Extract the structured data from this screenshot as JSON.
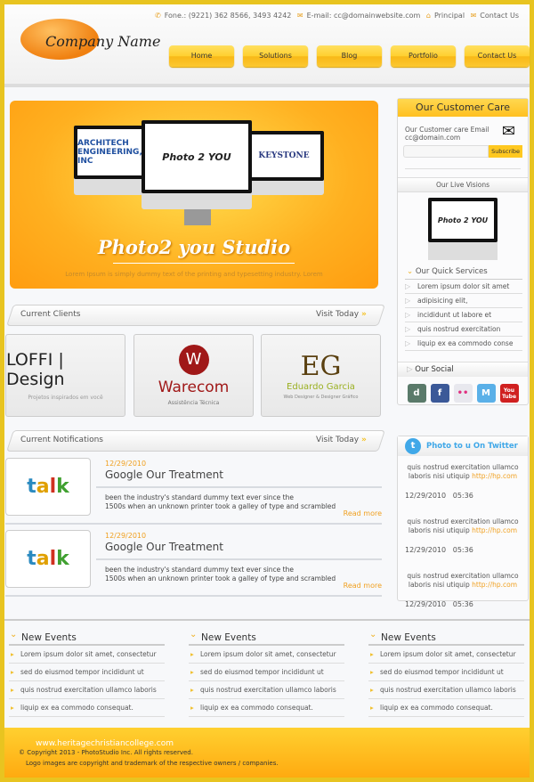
{
  "header": {
    "logo_text": "Company Name",
    "phone": "Fone.: (9221) 362 8566, 3493 4242",
    "email": "E-mail: cc@domainwebsite.com",
    "principal": "Principal",
    "contact": "Contact Us",
    "nav": [
      "Home",
      "Solutions",
      "Blog",
      "Portfolio",
      "Contact Us"
    ]
  },
  "hero": {
    "screens": [
      "ARCHITECH ENGINEERING, INC",
      "Photo 2 YOU",
      "KEYSTONE"
    ],
    "title": "Photo2 you Studio",
    "subtitle": "Lorem Ipsum is simply dummy text of the printing and typesetting industry. Lorem"
  },
  "clients": {
    "title": "Current Clients",
    "visit": "Visit Today",
    "items": [
      {
        "name": "LOFFI | Design",
        "tagline": "Projetos inspirados em você"
      },
      {
        "name": "Warecom",
        "tagline": "Assistência Técnica"
      },
      {
        "name": "Eduardo Garcia",
        "tagline": "Web Designer & Designer Gráfico"
      }
    ]
  },
  "notifications": {
    "title": "Current Notifications",
    "visit": "Visit Today",
    "items": [
      {
        "date": "12/29/2010",
        "title": "Google Our Treatment",
        "body1": "been the industry's standard dummy text ever since the",
        "body2": "1500s when an unknown printer took a galley of type and scrambled",
        "more": "Read more",
        "thumb": "talk"
      },
      {
        "date": "12/29/2010",
        "title": "Google Our Treatment",
        "body1": "been the industry's standard dummy text ever since the",
        "body2": "1500s when an unknown printer took a galley of type and scrambled",
        "more": "Read more",
        "thumb": "talk"
      }
    ]
  },
  "care": {
    "title": "Our Customer Care",
    "label": "Our Customer care Email",
    "email": "cc@domain.com",
    "input_value": "",
    "subscribe": "Subscribe",
    "live": "Our Live Visions",
    "live_screen": "Photo 2 YOU",
    "quick_title": "Our Quick Services",
    "quick": [
      "Lorem ipsum dolor sit amet",
      "adipisicing elit,",
      "incididunt ut labore et",
      "quis nostrud exercitation",
      "liquip ex ea commodo conse"
    ],
    "social_title": "Our Social",
    "social": [
      {
        "icon": "delicious-icon",
        "label": "d",
        "color": "#5a7a6a"
      },
      {
        "icon": "facebook-icon",
        "label": "f",
        "color": "#3b5998"
      },
      {
        "icon": "flickr-icon",
        "label": "••",
        "color": "#e8e8ee"
      },
      {
        "icon": "msn-icon",
        "label": "M",
        "color": "#5ab0e8"
      },
      {
        "icon": "youtube-icon",
        "label": "You Tube",
        "color": "#d02020"
      }
    ]
  },
  "twitter": {
    "title": "Photo to u On Twitter",
    "items": [
      {
        "text": "quis nostrud exercitation ullamco laboris nisi utiquip",
        "link": "http://hp.com",
        "date": "12/29/2010",
        "time": "05:36"
      },
      {
        "text": "quis nostrud exercitation ullamco laboris nisi utiquip",
        "link": "http://hp.com",
        "date": "12/29/2010",
        "time": "05:36"
      },
      {
        "text": "quis nostrud exercitation ullamco laboris nisi utiquip",
        "link": "http://hp.com",
        "date": "12/29/2010",
        "time": "05:36"
      }
    ]
  },
  "events": [
    {
      "title": "New Events",
      "items": [
        "Lorem ipsum dolor sit amet, consectetur",
        "sed do eiusmod tempor incididunt ut",
        "quis nostrud exercitation ullamco laboris",
        "liquip ex ea commodo consequat."
      ]
    },
    {
      "title": "New Events",
      "items": [
        "Lorem ipsum dolor sit amet, consectetur",
        "sed do eiusmod tempor incididunt ut",
        "quis nostrud exercitation ullamco laboris",
        "liquip ex ea commodo consequat."
      ]
    },
    {
      "title": "New Events",
      "items": [
        "Lorem ipsum dolor sit amet, consectetur",
        "sed do eiusmod tempor incididunt ut",
        "quis nostrud exercitation ullamco laboris",
        "liquip ex ea commodo consequat."
      ]
    }
  ],
  "footer": {
    "watermark": "www.heritagechristiancollege.com",
    "copyright": "© Copyright 2013 - PhotoStudio Inc. All rights reserved.",
    "logos": "Logo images are copyright and trademark of the respective owners / companies."
  },
  "colors": {
    "accent": "#ffc020",
    "border": "#e8c420",
    "link": "#f0a020"
  }
}
